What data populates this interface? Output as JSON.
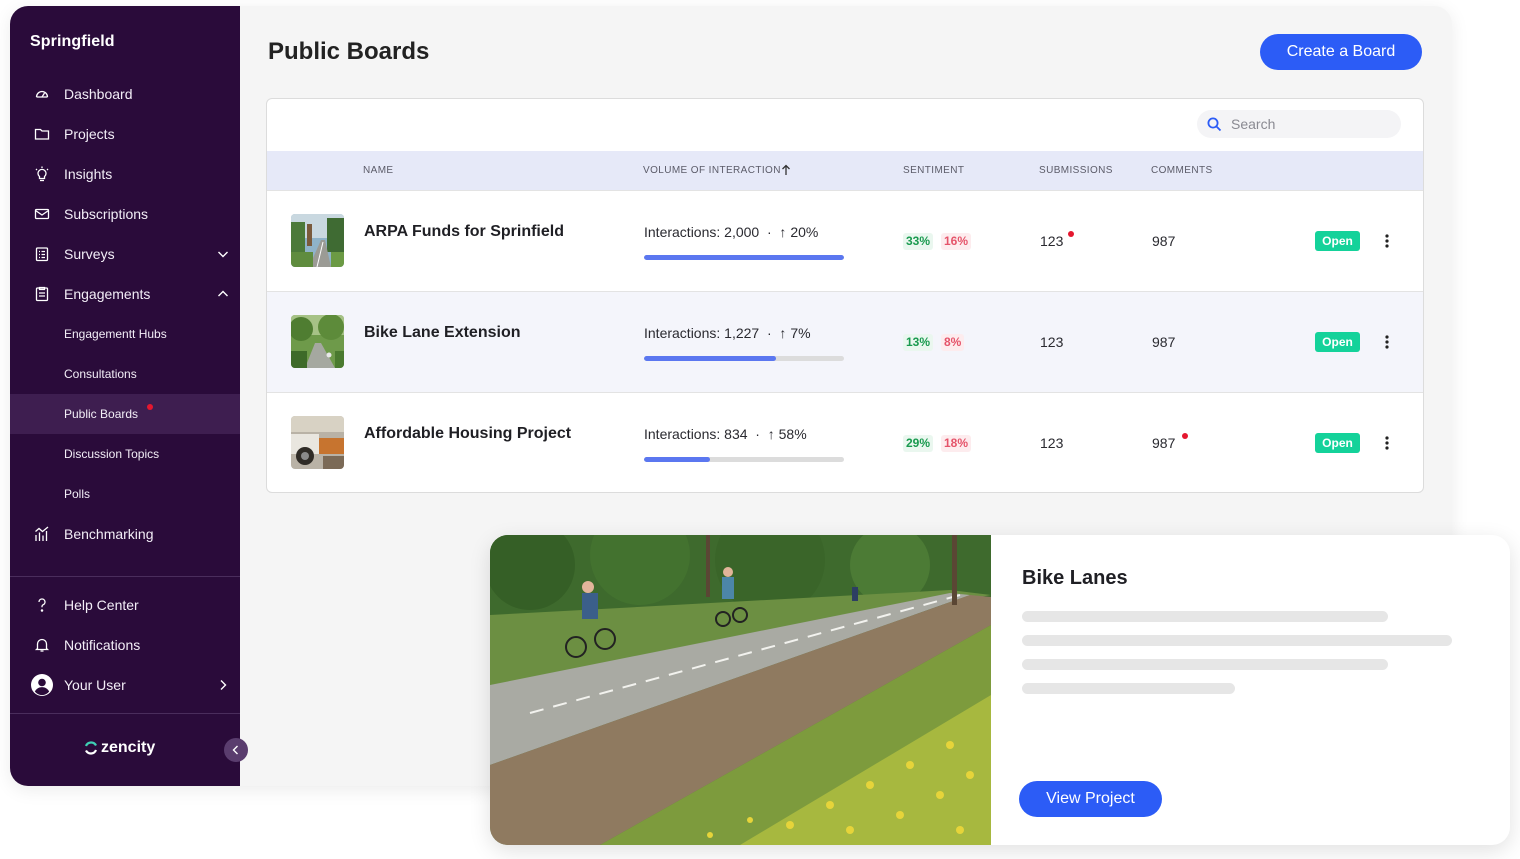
{
  "sidebar": {
    "brand": "Springfield",
    "items": [
      {
        "label": "Dashboard",
        "icon": "dashboard-gauge-icon"
      },
      {
        "label": "Projects",
        "icon": "folder-icon"
      },
      {
        "label": "Insights",
        "icon": "lightbulb-icon"
      },
      {
        "label": "Subscriptions",
        "icon": "envelope-icon"
      },
      {
        "label": "Surveys",
        "icon": "survey-clipboard-icon",
        "expander": "chevron-down-icon"
      },
      {
        "label": "Engagements",
        "icon": "engagement-clipboard-icon",
        "expander": "chevron-up-icon"
      }
    ],
    "subitems": [
      {
        "label": "Engagementt Hubs"
      },
      {
        "label": "Consultations"
      },
      {
        "label": "Public Boards",
        "active": true,
        "has_notification": true
      },
      {
        "label": "Discussion Topics"
      },
      {
        "label": "Polls"
      }
    ],
    "benchmarking": "Benchmarking",
    "bottom": {
      "help": "Help Center",
      "notifications": "Notifications",
      "user": "Your User"
    },
    "logo_text": "zencity"
  },
  "header": {
    "title": "Public Boards",
    "create_button": "Create a Board"
  },
  "table": {
    "search_placeholder": "Search",
    "columns": {
      "name": "NAME",
      "volume": "VOLUME OF INTERACTION",
      "sentiment": "SENTIMENT",
      "submissions": "SUBMISSIONS",
      "comments": "COMMENTS"
    },
    "rows": [
      {
        "name": "ARPA Funds for Sprinfield",
        "interactions": "Interactions: 2,000",
        "change": "20%",
        "progress": 1.0,
        "sentiment_pos": "33%",
        "sentiment_neg": "16%",
        "submissions": "123",
        "submissions_new": true,
        "comments": "987",
        "comments_new": false,
        "status": "Open"
      },
      {
        "name": "Bike Lane Extension",
        "interactions": "Interactions: 1,227",
        "change": "7%",
        "progress": 0.66,
        "sentiment_pos": "13%",
        "sentiment_neg": "8%",
        "submissions": "123",
        "submissions_new": false,
        "comments": "987",
        "comments_new": false,
        "status": "Open"
      },
      {
        "name": "Affordable Housing Project",
        "interactions": "Interactions: 834",
        "change": "58%",
        "progress": 0.33,
        "sentiment_pos": "29%",
        "sentiment_neg": "18%",
        "submissions": "123",
        "submissions_new": false,
        "comments": "987",
        "comments_new": true,
        "status": "Open"
      }
    ]
  },
  "project_card": {
    "title": "Bike Lanes",
    "button": "View Project"
  },
  "colors": {
    "sidebar_bg": "#2a0b3a",
    "primary": "#2c5cf6",
    "open_badge": "#14d29a",
    "positive": "#1a9a4f",
    "negative": "#e5546a",
    "notification_dot": "#e5172f"
  }
}
